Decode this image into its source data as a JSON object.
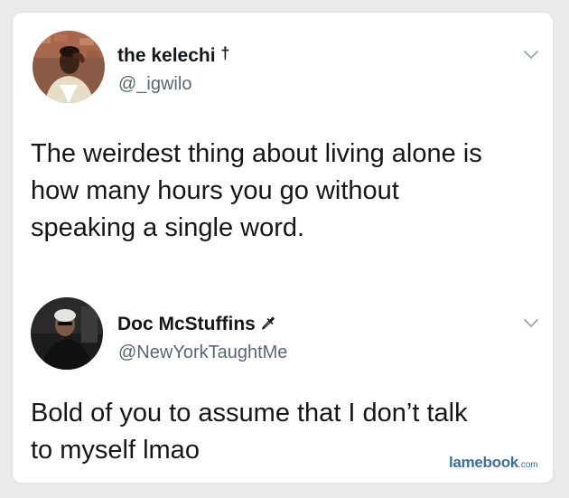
{
  "tweets": [
    {
      "display_name": "the kelechi",
      "name_symbol": "†",
      "handle": "@_igwilo",
      "body_lines": [
        "The weirdest thing about living alone is",
        "how many hours you go without",
        "speaking a single word."
      ],
      "menu_icon": "chevron-down-icon"
    },
    {
      "display_name": "Doc McStuffins",
      "name_symbol": "🗡",
      "handle": "@NewYorkTaughtMe",
      "body_lines": [
        "Bold of you to assume that I don’t talk",
        "to myself lmao"
      ],
      "menu_icon": "chevron-down-icon"
    }
  ],
  "watermark": {
    "name": "lamebook",
    "tld": ".com"
  },
  "colors": {
    "text": "#14171a",
    "handle": "#5b6670",
    "watermark": "#3c6f9c",
    "card": "#ffffff"
  }
}
